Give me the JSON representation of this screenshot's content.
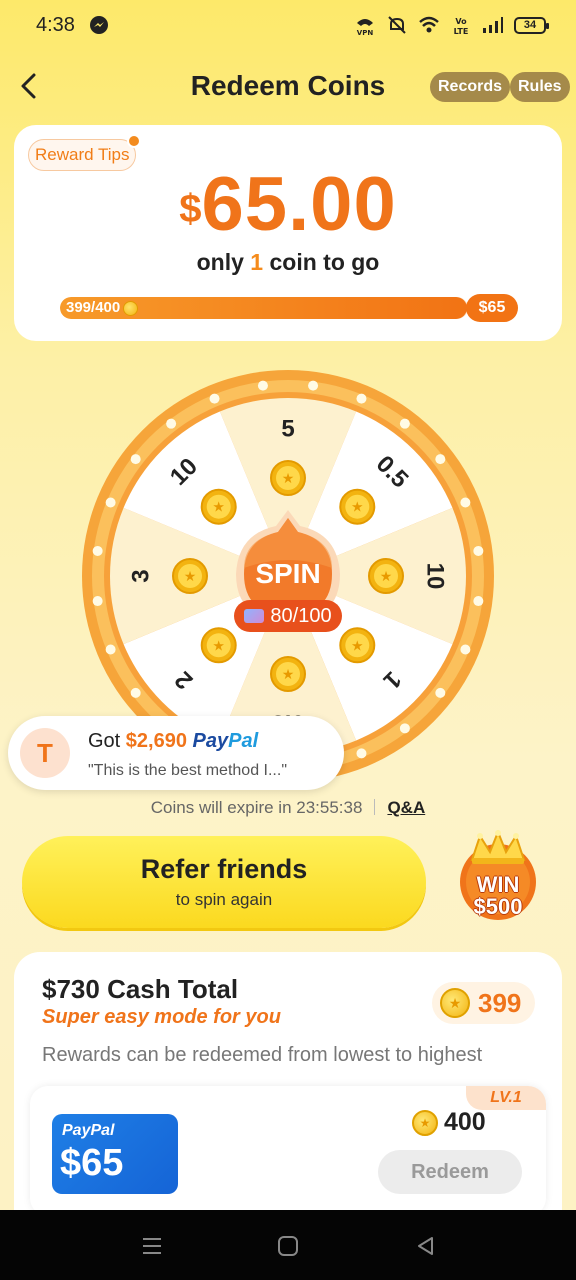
{
  "status_bar": {
    "time": "4:38",
    "battery": "34"
  },
  "header": {
    "title": "Redeem Coins",
    "records_label": "Records",
    "rules_label": "Rules"
  },
  "reward": {
    "tips_label": "Reward Tips",
    "currency": "$",
    "amount": "65.00",
    "sub_prefix": "only ",
    "sub_count": "1",
    "sub_suffix": " coin to go",
    "progress_text": "399/400",
    "progress_fraction": 0.9975,
    "target_label": "$65"
  },
  "wheel": {
    "segments": [
      "5",
      "0.5",
      "10",
      "1",
      "0.3",
      "2",
      "3",
      "10"
    ],
    "spin_label": "SPIN",
    "spin_count": "80/100"
  },
  "toast": {
    "avatar_letter": "T",
    "got": "Got ",
    "amount": "$2,690",
    "brand_pay": "Pay",
    "brand_pal": "Pal",
    "quote": "\"This is the best method I...\""
  },
  "expire": {
    "text": "Coins will expire in 23:55:38",
    "qa_label": "Q&A"
  },
  "refer": {
    "title": "Refer friends",
    "subtitle": "to spin again",
    "win_line1": "WIN",
    "win_line2": "$500"
  },
  "cash": {
    "title": "$730 Cash Total",
    "subtitle": "Super easy mode for you",
    "coin_balance": "399",
    "description": "Rewards can be redeemed from lowest to highest",
    "tier": {
      "level": "LV.1",
      "card_brand": "PayPal",
      "card_amount": "$65",
      "cost": "400",
      "redeem_label": "Redeem"
    }
  },
  "colors": {
    "accent": "#f0741a",
    "background": "#fde96a",
    "paypal": "#1f7fe6"
  }
}
